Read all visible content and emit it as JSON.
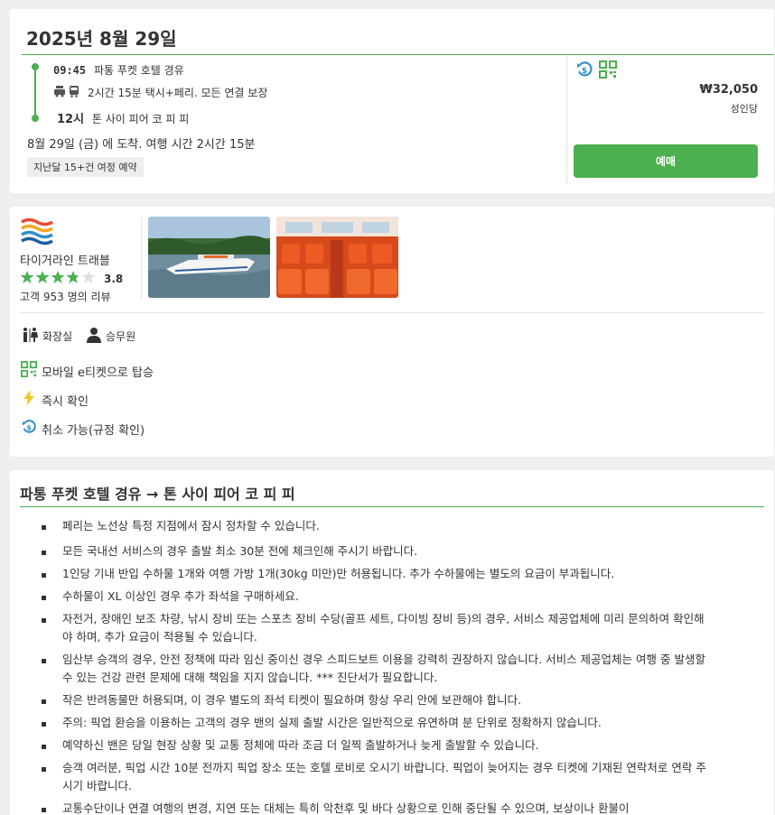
{
  "trip": {
    "date_title": "2025년 8월 29일",
    "departure_time": "09:45",
    "departure_place": "파통 푸켓 호텔 경유",
    "transport_desc": "2시간 15분 택시+페리. 모든 연결 보장",
    "arrival_time": "12시",
    "arrival_place": "톤 사이 피어 코 피 피",
    "arrival_summary": "8월 29일 (금) 에 도착. 여행 시간 2시간 15분",
    "popularity_badge": "지난달 15+건 여정 예약",
    "price": "₩32,050",
    "price_unit": "성인당",
    "book_label": "예매",
    "icons": [
      "refund-icon",
      "qr-code-icon",
      "taxi-icon",
      "bus-icon"
    ]
  },
  "operator": {
    "name": "타이거라인 트래블",
    "rating": "3.8",
    "rating_stars": 3.8,
    "reviews": "고객 953 명의 리뷰",
    "amenities": [
      {
        "label": "화장실",
        "icon": "restroom-icon"
      },
      {
        "label": "승무원",
        "icon": "crew-icon"
      }
    ],
    "features": [
      {
        "label": "모바일 e티켓으로 탑승",
        "icon": "qr-code-icon"
      },
      {
        "label": "즉시 확인",
        "icon": "lightning-icon"
      },
      {
        "label": "취소 가능(규정 확인)",
        "icon": "refund-icon"
      }
    ]
  },
  "route": {
    "title": "파통 푸켓 호텔 경유 → 톤 사이 피어 코 피 피",
    "notes": [
      "페리는 노선상 특정 지점에서 잠시 정차할 수 있습니다.",
      "모든 국내선 서비스의 경우 출발 최소 30분 전에 체크인해 주시기 바랍니다.",
      "1인당 기내 반입 수하물 1개와 여행 가방 1개(30kg 미만)만 허용됩니다. 추가 수하물에는 별도의 요금이 부과됩니다.",
      "수하물이 XL 이상인 경우 추가 좌석을 구매하세요.",
      "자전거, 장애인 보조 차량, 낚시 장비 또는 스포츠 장비 수당(골프 세트, 다이빙 장비 등)의 경우, 서비스 제공업체에 미리 문의하여 확인해야 하며, 추가 요금이 적용될 수 있습니다.",
      "임산부 승객의 경우, 안전 정책에 따라 임신 중이신 경우 스피드보트 이용을 강력히 권장하지 않습니다. 서비스 제공업체는 여행 중 발생할 수 있는 건강 관련 문제에 대해 책임을 지지 않습니다. *** 진단서가 필요합니다.",
      "작은 반려동물만 허용되며, 이 경우 별도의 좌석 티켓이 필요하며 항상 우리 안에 보관해야 합니다.",
      "주의: 픽업 환승을 이용하는 고객의 경우 밴의 실제 출발 시간은 일반적으로 유연하며 분 단위로 정확하지 않습니다.",
      "예약하신 밴은 당일 현장 상황 및 교통 정체에 따라 조금 더 일찍 출발하거나 늦게 출발할 수 있습니다.",
      "승객 여러분, 픽업 시간 10분 전까지 픽업 장소 또는 호텔 로비로 오시기 바랍니다. 픽업이 늦어지는 경우 티켓에 기재된 연락처로 연락 주시기 바랍니다.",
      "교통수단이나 연결 여행의 변경, 지연 또는 대체는 특히 악천후 및 바다 상황으로 인해 중단될 수 있으며, 보상이나 환불이"
    ]
  },
  "colors": {
    "accent_green": "#4caf50",
    "refund_blue": "#2f8fc7",
    "lightning_yellow": "#f5c518"
  }
}
